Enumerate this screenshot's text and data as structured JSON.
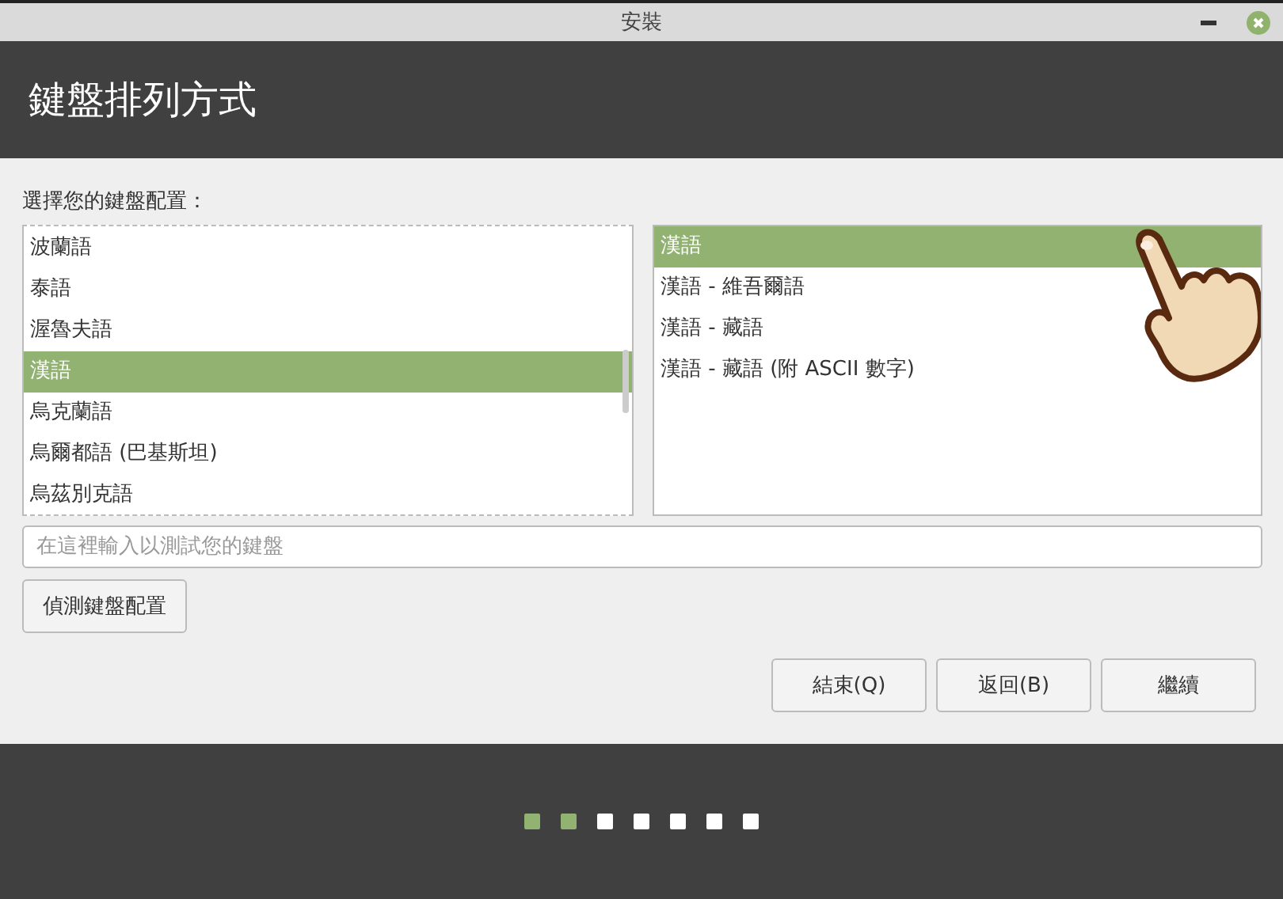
{
  "window": {
    "title": "安裝"
  },
  "header": {
    "title": "鍵盤排列方式"
  },
  "layout_label": "選擇您的鍵盤配置：",
  "layouts": [
    {
      "label": "波蘭語",
      "selected": false
    },
    {
      "label": "泰語",
      "selected": false
    },
    {
      "label": "渥魯夫語",
      "selected": false
    },
    {
      "label": "漢語",
      "selected": true
    },
    {
      "label": "烏克蘭語",
      "selected": false
    },
    {
      "label": "烏爾都語 (巴基斯坦)",
      "selected": false
    },
    {
      "label": "烏茲別克語",
      "selected": false
    }
  ],
  "variants": [
    {
      "label": "漢語",
      "selected": true
    },
    {
      "label": "漢語 - 維吾爾語",
      "selected": false
    },
    {
      "label": "漢語 - 藏語",
      "selected": false
    },
    {
      "label": "漢語 - 藏語 (附 ASCII 數字)",
      "selected": false
    }
  ],
  "test_field": {
    "placeholder": "在這裡輸入以測試您的鍵盤"
  },
  "detect_button": "偵測鍵盤配置",
  "buttons": [
    "結束(Q)",
    "返回(B)",
    "繼續"
  ],
  "steps": [
    {
      "done": true
    },
    {
      "done": true
    },
    {
      "done": false
    },
    {
      "done": false
    },
    {
      "done": false
    },
    {
      "done": false
    },
    {
      "done": false
    }
  ]
}
